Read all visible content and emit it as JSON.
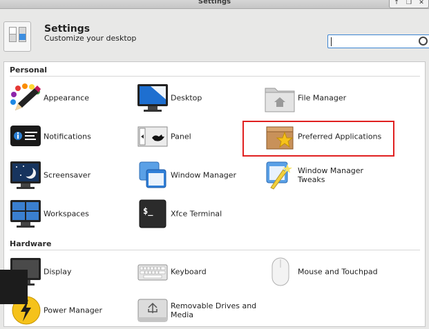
{
  "window": {
    "title": "Settings",
    "controls": {
      "up": "↑",
      "restore": "❐",
      "close": "✕"
    }
  },
  "header": {
    "title": "Settings",
    "subtitle": "Customize your desktop",
    "search_placeholder": ""
  },
  "sections": [
    {
      "title": "Personal",
      "items": [
        {
          "label": "Appearance",
          "icon": "appearance-icon"
        },
        {
          "label": "Desktop",
          "icon": "desktop-icon"
        },
        {
          "label": "File Manager",
          "icon": "file-manager-icon"
        },
        {
          "label": "Notifications",
          "icon": "notifications-icon"
        },
        {
          "label": "Panel",
          "icon": "panel-icon"
        },
        {
          "label": "Preferred Applications",
          "icon": "preferred-applications-icon"
        },
        {
          "label": "Screensaver",
          "icon": "screensaver-icon"
        },
        {
          "label": "Window Manager",
          "icon": "window-manager-icon"
        },
        {
          "label": "Window Manager Tweaks",
          "icon": "window-manager-tweaks-icon"
        },
        {
          "label": "Workspaces",
          "icon": "workspaces-icon"
        },
        {
          "label": "Xfce Terminal",
          "icon": "terminal-icon"
        }
      ]
    },
    {
      "title": "Hardware",
      "items": [
        {
          "label": "Display",
          "icon": "display-icon"
        },
        {
          "label": "Keyboard",
          "icon": "keyboard-icon"
        },
        {
          "label": "Mouse and Touchpad",
          "icon": "mouse-icon"
        },
        {
          "label": "Power Manager",
          "icon": "power-manager-icon"
        },
        {
          "label": "Removable Drives and Media",
          "icon": "removable-drives-icon"
        }
      ]
    }
  ],
  "colors": {
    "highlight": "#e02020",
    "accent": "#3b84d1"
  }
}
